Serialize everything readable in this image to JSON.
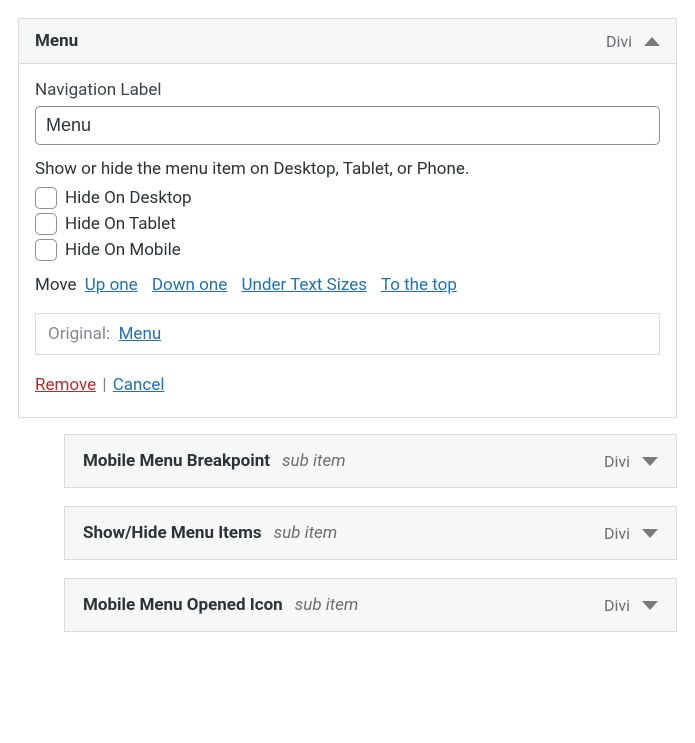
{
  "expanded": {
    "title": "Menu",
    "type": "Divi",
    "nav_label_field": "Navigation Label",
    "nav_label_value": "Menu",
    "visibility_desc": "Show or hide the menu item on Desktop, Tablet, or Phone.",
    "checkboxes": {
      "desktop": "Hide On Desktop",
      "tablet": "Hide On Tablet",
      "mobile": "Hide On Mobile"
    },
    "move": {
      "label": "Move",
      "up_one": "Up one",
      "down_one": "Down one",
      "under": "Under Text Sizes",
      "to_top": "To the top"
    },
    "original": {
      "label": "Original:",
      "link": "Menu"
    },
    "actions": {
      "remove": "Remove",
      "separator": "|",
      "cancel": "Cancel"
    }
  },
  "sub_badge": "sub item",
  "sub_items": [
    {
      "title": "Mobile Menu Breakpoint",
      "type": "Divi"
    },
    {
      "title": "Show/Hide Menu Items",
      "type": "Divi"
    },
    {
      "title": "Mobile Menu Opened Icon",
      "type": "Divi"
    }
  ]
}
